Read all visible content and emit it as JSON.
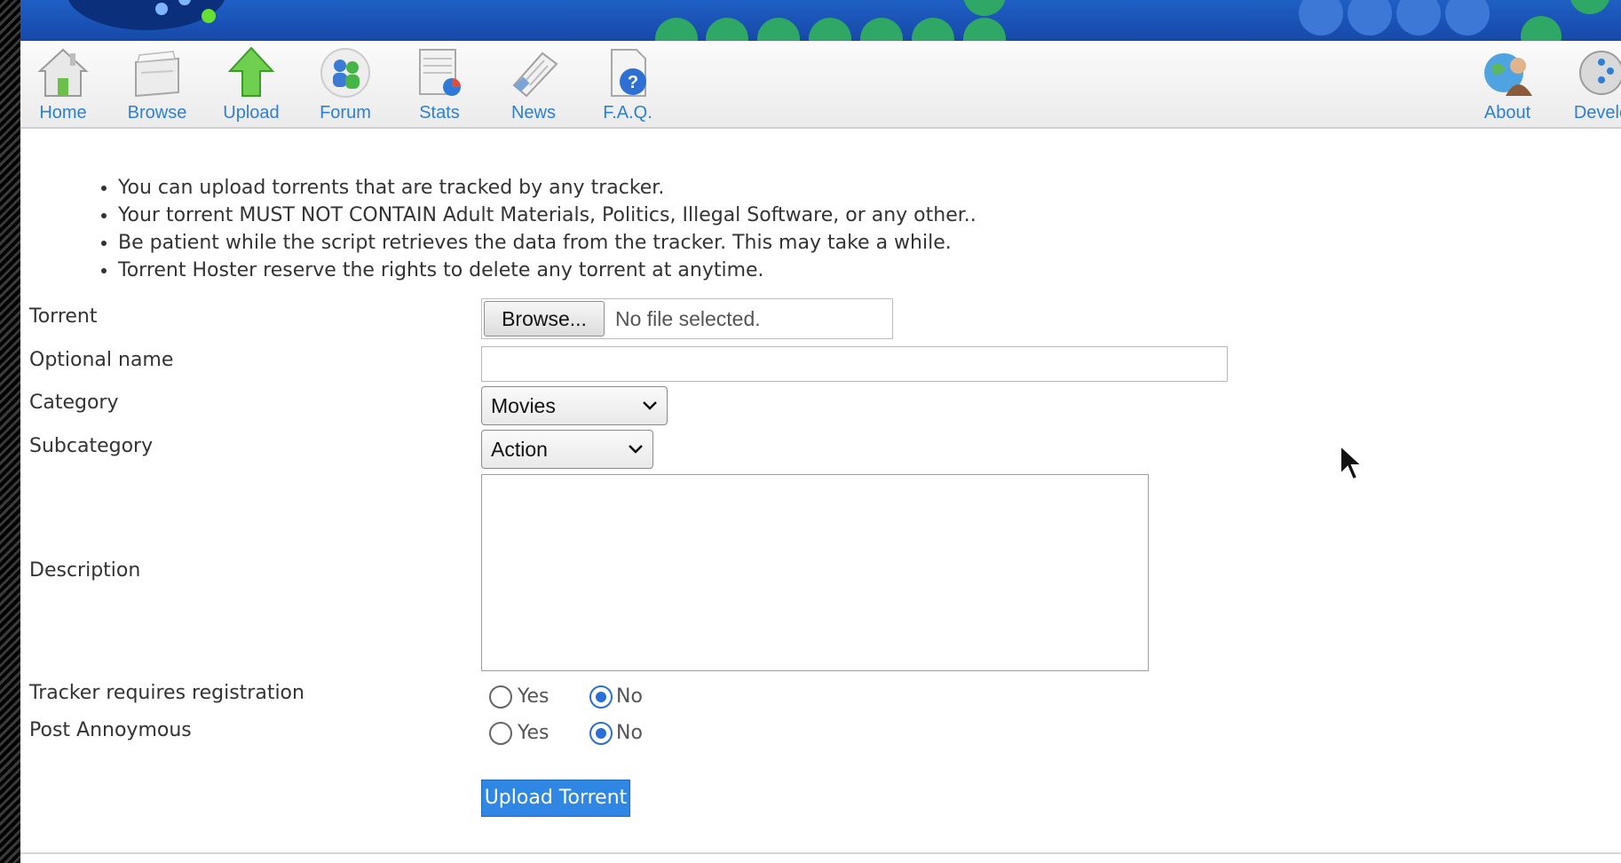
{
  "nav": {
    "items": [
      {
        "label": "Home",
        "icon": "home-icon"
      },
      {
        "label": "Browse",
        "icon": "browse-icon"
      },
      {
        "label": "Upload",
        "icon": "upload-arrow-icon"
      },
      {
        "label": "Forum",
        "icon": "forum-users-icon"
      },
      {
        "label": "Stats",
        "icon": "stats-chart-icon"
      },
      {
        "label": "News",
        "icon": "news-paper-icon"
      },
      {
        "label": "F.A.Q.",
        "icon": "faq-question-icon"
      },
      {
        "label": "About",
        "icon": "about-globe-user-icon"
      },
      {
        "label": "Develo",
        "icon": "developer-globe-icon"
      }
    ]
  },
  "notes": [
    "You can upload torrents that are tracked by any tracker.",
    "Your torrent MUST NOT CONTAIN Adult Materials, Politics, Illegal Software, or any other..",
    "Be patient while the script retrieves the data from the tracker. This may take a while.",
    "Torrent Hoster reserve the rights to delete any torrent at anytime."
  ],
  "form": {
    "torrent_label": "Torrent",
    "browse_label": "Browse...",
    "file_status": "No file selected.",
    "optional_name_label": "Optional name",
    "optional_name_value": "",
    "category_label": "Category",
    "category_value": "Movies",
    "subcategory_label": "Subcategory",
    "subcategory_value": "Action",
    "description_label": "Description",
    "description_value": "",
    "tracker_reg_label": "Tracker requires registration",
    "tracker_reg_selected": "No",
    "post_anon_label": "Post Annoymous",
    "post_anon_selected": "No",
    "yes_label": "Yes",
    "no_label": "No",
    "submit_label": "Upload Torrent"
  },
  "colors": {
    "banner": "#1f5fc4",
    "nav_link": "#2d7fd6",
    "button": "#2f86e3",
    "radio_selected": "#2a6fd6"
  }
}
